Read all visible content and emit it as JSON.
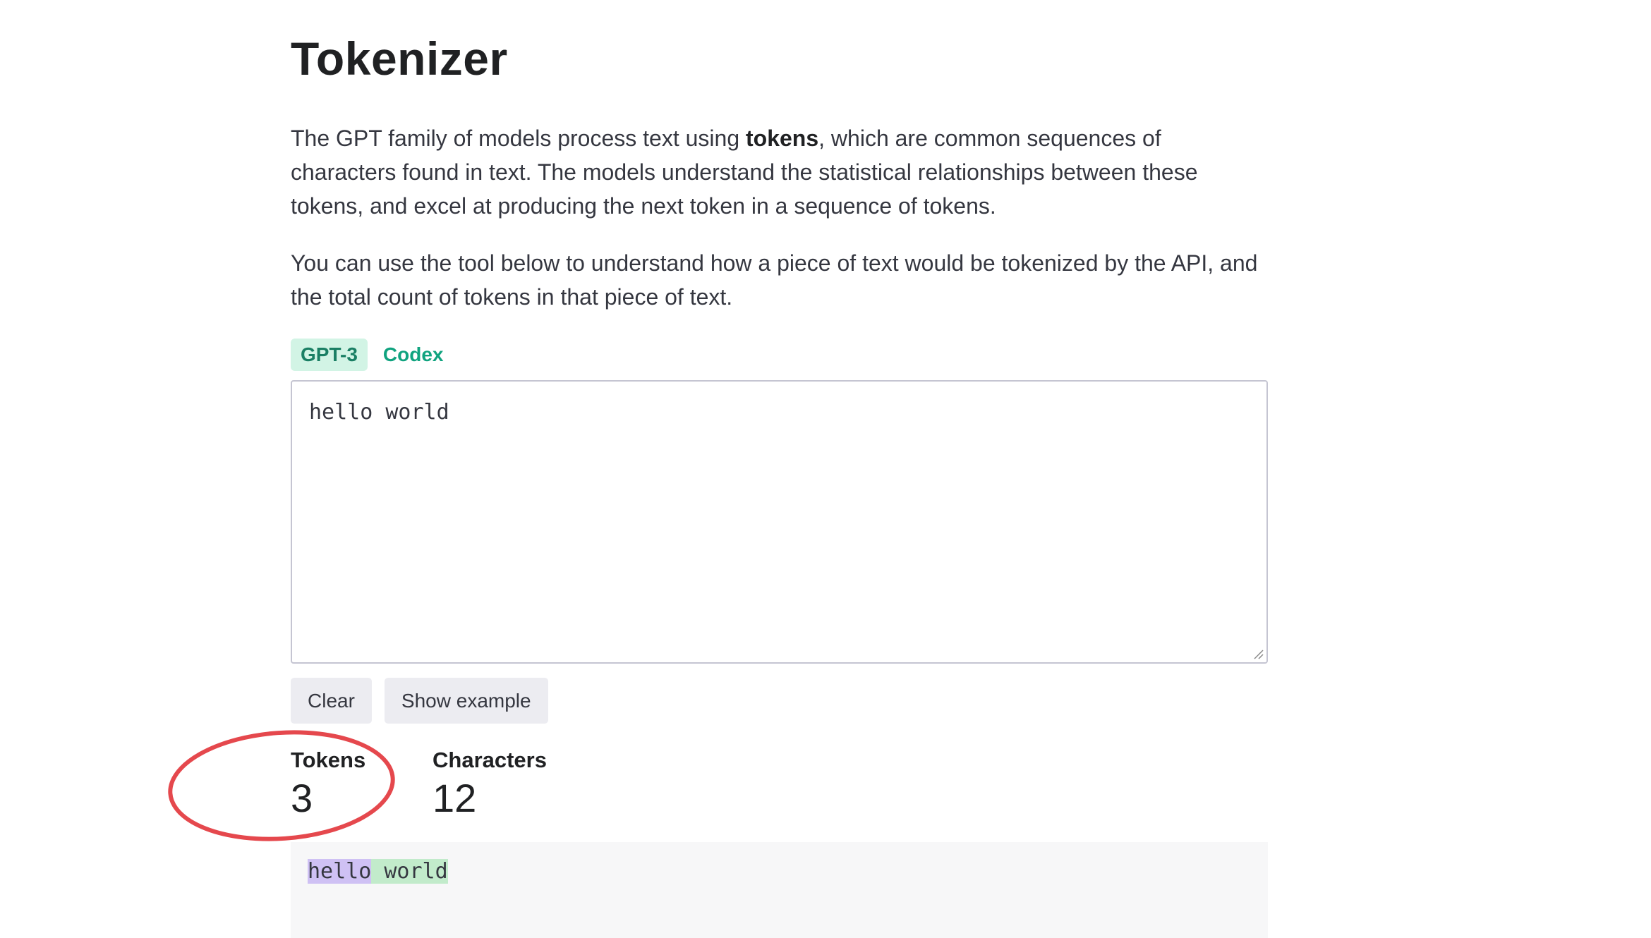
{
  "page": {
    "title": "Tokenizer",
    "intro": {
      "before_bold": "The GPT family of models process text using ",
      "bold": "tokens",
      "after_bold": ", which are common sequences of characters found in text. The models understand the statistical relationships between these tokens, and excel at producing the next token in a sequence of tokens."
    },
    "instructions": "You can use the tool below to understand how a piece of text would be tokenized by the API, and the total count of tokens in that piece of text."
  },
  "tabs": [
    {
      "label": "GPT-3",
      "active": true
    },
    {
      "label": "Codex",
      "active": false
    }
  ],
  "input": {
    "value": "hello world"
  },
  "buttons": {
    "clear": "Clear",
    "show_example": "Show example"
  },
  "stats": {
    "tokens_label": "Tokens",
    "tokens_value": "3",
    "characters_label": "Characters",
    "characters_value": "12"
  },
  "output": {
    "tokens": [
      "hello",
      " world"
    ]
  },
  "colors": {
    "accent": "#10a37f",
    "annotation": "#e5484d",
    "token_1": "#cfc1f4",
    "token_2": "#c2ebcb"
  }
}
